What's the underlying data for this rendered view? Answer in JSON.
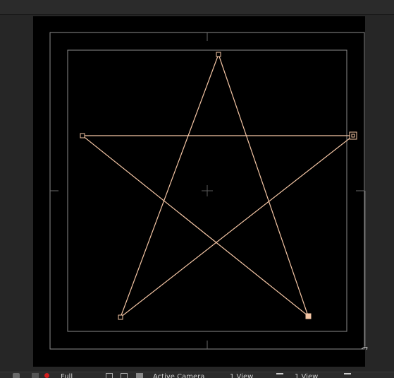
{
  "viewer": {
    "shape_stroke_color": "#f5c6a5",
    "guide_color": "#8c8c8c",
    "canvas_color": "#000000"
  },
  "shape": {
    "name": "star-path",
    "vertices": [
      "top",
      "left",
      "right",
      "bottom-left",
      "bottom-right"
    ]
  },
  "toolbar": {
    "magnification_value": "Full",
    "active_camera_value": "Active Camera",
    "views_value_1": "1 View",
    "views_value_2": "1 View",
    "icons": [
      "snapshot-icon",
      "camera-icon",
      "color-dot-icon",
      "resolution-icon",
      "grid-icon",
      "transparency-icon",
      "views-arrows-icon",
      "views-arrows-icon"
    ]
  }
}
